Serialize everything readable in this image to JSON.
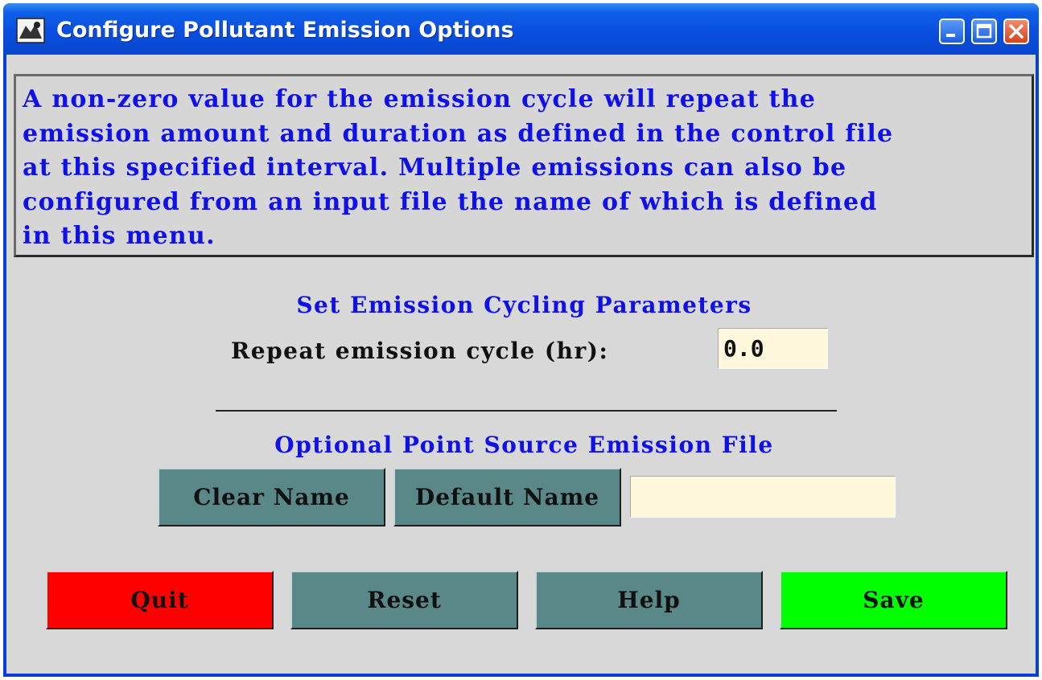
{
  "window": {
    "title": "Configure Pollutant Emission Options"
  },
  "info_text": "A non-zero value for the emission cycle will repeat the\nemission amount and duration as defined in the control file\nat this specified interval. Multiple emissions can also be\nconfigured from an input file the name of which is defined\nin this menu.",
  "cycling": {
    "heading": "Set Emission Cycling Parameters",
    "repeat_label": "Repeat emission cycle (hr):",
    "repeat_value": "0.0"
  },
  "point_source": {
    "heading": "Optional Point Source Emission File",
    "clear_label": "Clear Name",
    "default_label": "Default Name",
    "file_value": ""
  },
  "actions": {
    "quit_label": "Quit",
    "reset_label": "Reset",
    "help_label": "Help",
    "save_label": "Save"
  },
  "colors": {
    "title_bar": "#0a4fe0",
    "info_text": "#1010e8",
    "teal_button": "#5a8888",
    "quit_button": "#ff0000",
    "save_button": "#00ff00",
    "input_bg": "#fff8dc"
  },
  "icons": {
    "app": "app-icon",
    "minimize": "minimize-icon",
    "maximize": "maximize-icon",
    "close": "close-icon"
  }
}
